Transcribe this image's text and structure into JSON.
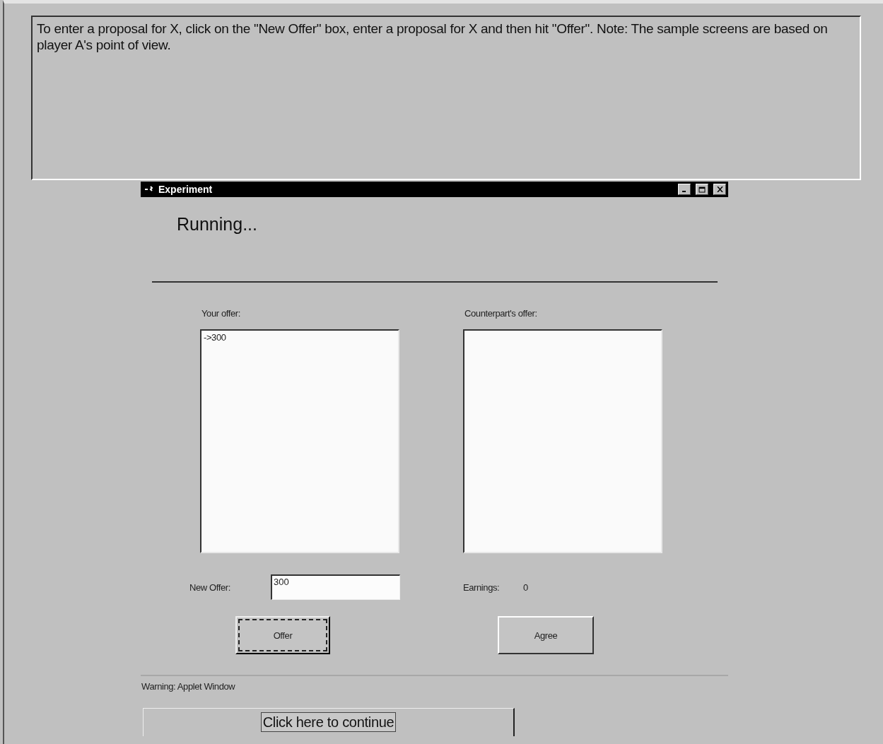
{
  "instructions": "To enter a proposal for X, click on the \"New Offer\" box, enter a proposal for X and then hit \"Offer\". Note: The sample screens are based on player A's point of view.",
  "window": {
    "title": "Experiment",
    "status": "Running..."
  },
  "your_offer": {
    "label": "Your offer:",
    "items": [
      "->300"
    ]
  },
  "counterpart_offer": {
    "label": "Counterpart's offer:"
  },
  "new_offer": {
    "label": "New Offer:",
    "value": "300"
  },
  "earnings": {
    "label": "Earnings:",
    "value": "0"
  },
  "buttons": [
    {
      "label": "Offer",
      "focused": true
    },
    {
      "label": "Agree",
      "focused": false
    }
  ],
  "status_bar": "Warning: Applet Window",
  "continue_button": "Click here to continue"
}
